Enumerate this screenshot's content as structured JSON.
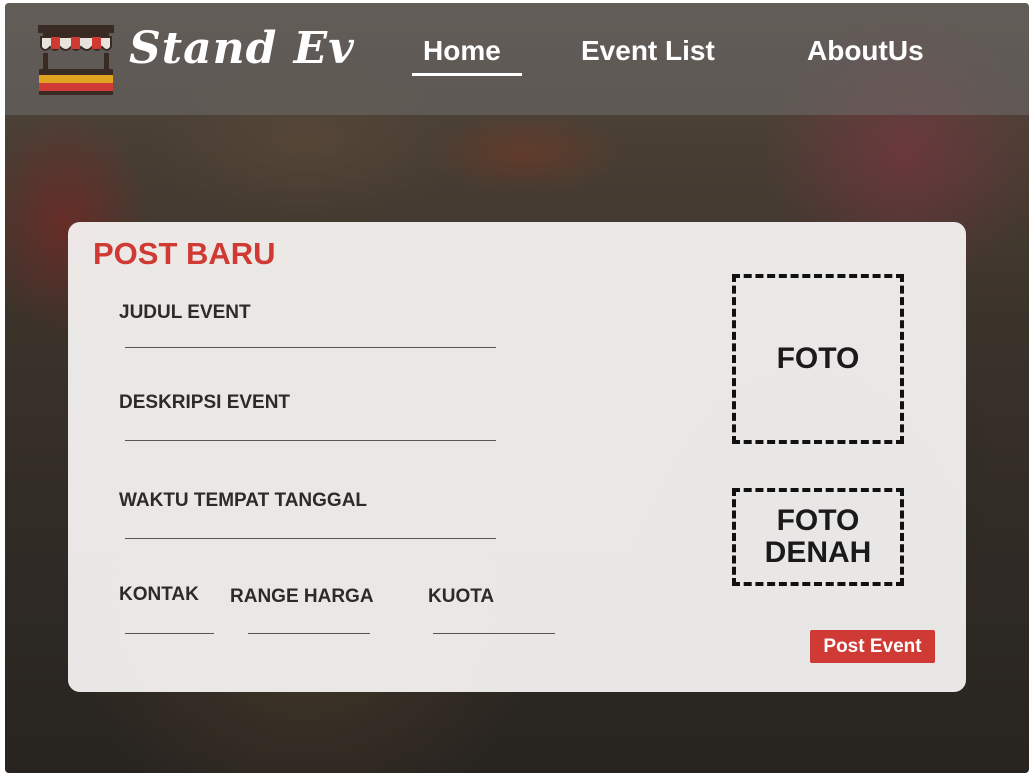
{
  "brand": {
    "name": "Stand Ev"
  },
  "nav": {
    "home": "Home",
    "event_list": "Event List",
    "about": "AboutUs"
  },
  "form": {
    "title": "POST BARU",
    "fields": {
      "judul": "JUDUL EVENT",
      "deskripsi": "DESKRIPSI EVENT",
      "waktu": "WAKTU TEMPAT TANGGAL",
      "kontak": "KONTAK",
      "harga": "RANGE HARGA",
      "kuota": "KUOTA"
    },
    "foto": "FOTO",
    "foto_denah_1": "FOTO",
    "foto_denah_2": "DENAH",
    "submit": "Post Event"
  },
  "colors": {
    "accent": "#cf3a35",
    "text_dark": "#2e2a28"
  }
}
